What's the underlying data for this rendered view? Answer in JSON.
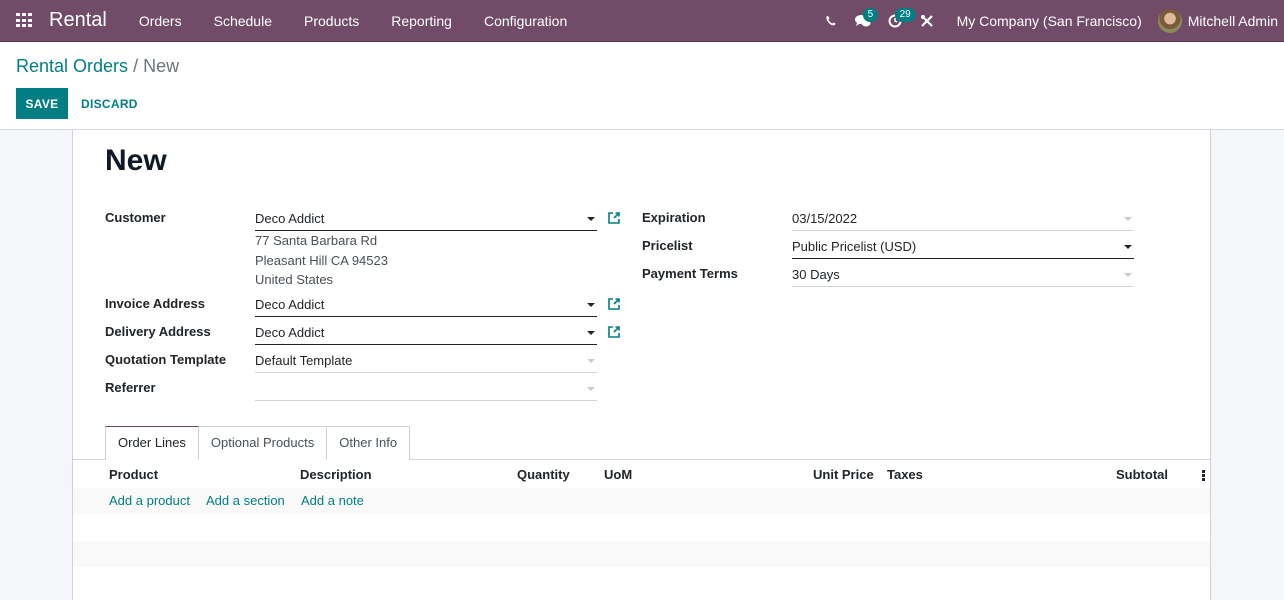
{
  "navbar": {
    "app_name": "Rental",
    "menu": [
      "Orders",
      "Schedule",
      "Products",
      "Reporting",
      "Configuration"
    ],
    "messages_badge": "5",
    "activities_badge": "29",
    "company": "My Company (San Francisco)",
    "user": "Mitchell Admin"
  },
  "breadcrumb": {
    "parent": "Rental Orders",
    "separator": "/",
    "current": "New"
  },
  "buttons": {
    "save": "SAVE",
    "discard": "DISCARD"
  },
  "form": {
    "title": "New",
    "left_fields": {
      "customer": {
        "label": "Customer",
        "value": "Deco Addict"
      },
      "customer_address": [
        "77 Santa Barbara Rd",
        "Pleasant Hill CA 94523",
        "United States"
      ],
      "invoice_address": {
        "label": "Invoice Address",
        "value": "Deco Addict"
      },
      "delivery_address": {
        "label": "Delivery Address",
        "value": "Deco Addict"
      },
      "quotation_template": {
        "label": "Quotation Template",
        "value": "Default Template"
      },
      "referrer": {
        "label": "Referrer",
        "value": ""
      }
    },
    "right_fields": {
      "expiration": {
        "label": "Expiration",
        "value": "03/15/2022"
      },
      "pricelist": {
        "label": "Pricelist",
        "value": "Public Pricelist (USD)"
      },
      "payment_terms": {
        "label": "Payment Terms",
        "value": "30 Days"
      }
    }
  },
  "tabs": [
    {
      "label": "Order Lines",
      "active": true
    },
    {
      "label": "Optional Products",
      "active": false
    },
    {
      "label": "Other Info",
      "active": false
    }
  ],
  "order_lines": {
    "columns": [
      "Product",
      "Description",
      "Quantity",
      "UoM",
      "Unit Price",
      "Taxes",
      "Subtotal"
    ],
    "actions": [
      "Add a product",
      "Add a section",
      "Add a note"
    ]
  }
}
